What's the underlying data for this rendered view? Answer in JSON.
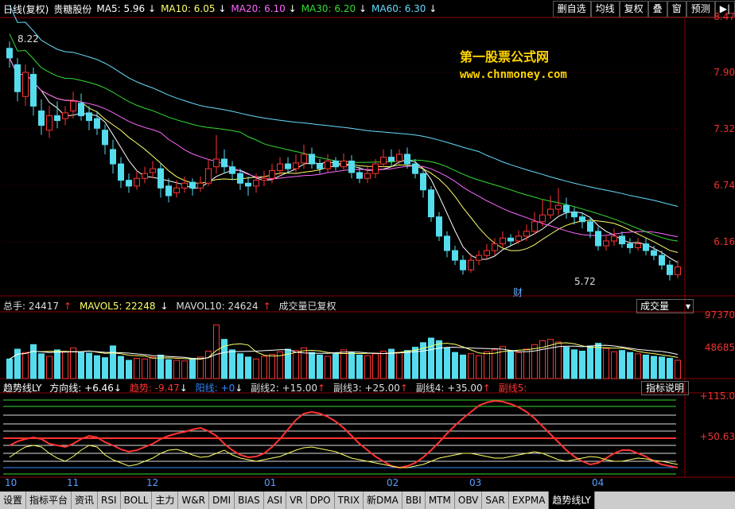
{
  "header": {
    "title": "日线(复权)",
    "stock": "贵糖股份",
    "ma": [
      {
        "label": "MA5: 5.96",
        "arrow": "↓",
        "color": "#ffffff"
      },
      {
        "label": "MA10: 6.05",
        "arrow": "↓",
        "color": "#ffff66"
      },
      {
        "label": "MA20: 6.10",
        "arrow": "↓",
        "color": "#ff66ff"
      },
      {
        "label": "MA30: 6.20",
        "arrow": "↓",
        "color": "#33dd33"
      },
      {
        "label": "MA60: 6.30",
        "arrow": "↓",
        "color": "#66ddff"
      }
    ],
    "buttons": [
      "删自选",
      "均线",
      "复权",
      "叠",
      "窗",
      "预测",
      "▶|"
    ]
  },
  "watermark": {
    "line1": "第一股票公式网",
    "line2": "www.chnmoney.com"
  },
  "price_axis": [
    "8.47",
    "7.90",
    "7.32",
    "6.74",
    "6.16"
  ],
  "annotations": {
    "high": "8.22",
    "low": "5.72",
    "cai": "财"
  },
  "volume": {
    "label_total": "总手: 24417",
    "total_arrow": "↑",
    "mavol5": "MAVOL5: 22248",
    "mavol5_arrow": "↓",
    "mavol10": "MAVOL10: 24624",
    "mavol10_arrow": "↑",
    "note": "成交量已复权",
    "selector": "成交量",
    "axis": [
      "97370",
      "48685"
    ]
  },
  "indicator": {
    "name": "趋势线LY",
    "items": [
      {
        "label": "方向线:",
        "value": "+6.46",
        "arrow": "↓",
        "color": "#ffffff"
      },
      {
        "label": "趋势:",
        "value": "-9.47",
        "arrow": "↓",
        "color": "#ff3333"
      },
      {
        "label": "阳线:",
        "value": "+0",
        "arrow": "↓",
        "color": "#3388ff"
      },
      {
        "label": "副线2:",
        "value": "+15.00",
        "arrow": "↑",
        "color": "#dddddd"
      },
      {
        "label": "副线3:",
        "value": "+25.00",
        "arrow": "↑",
        "color": "#dddddd"
      },
      {
        "label": "副线4:",
        "value": "+35.00",
        "arrow": "↑",
        "color": "#dddddd"
      },
      {
        "label": "副线5:",
        "value": "",
        "arrow": "",
        "color": "#ff3333"
      }
    ],
    "help": "指标说明",
    "axis": [
      "+115.0",
      "+50.63"
    ]
  },
  "months": [
    "10",
    "11",
    "12",
    "01",
    "02",
    "03",
    "04"
  ],
  "tabs": [
    "设置",
    "指标平台",
    "资讯",
    "RSI",
    "BOLL",
    "主力",
    "W&R",
    "DMI",
    "BIAS",
    "ASI",
    "VR",
    "DPO",
    "TRIX",
    "新DMA",
    "BBI",
    "MTM",
    "OBV",
    "SAR",
    "EXPMA",
    "趋势线LY"
  ],
  "chart_data": {
    "type": "candlestick",
    "ylim": [
      5.58,
      8.47
    ],
    "candles": [
      [
        8.15,
        8.05,
        8.22,
        7.95
      ],
      [
        7.98,
        7.7,
        8.05,
        7.6
      ],
      [
        7.65,
        7.9,
        7.98,
        7.55
      ],
      [
        7.88,
        7.55,
        7.95,
        7.45
      ],
      [
        7.5,
        7.35,
        7.62,
        7.25
      ],
      [
        7.3,
        7.45,
        7.55,
        7.22
      ],
      [
        7.45,
        7.4,
        7.6,
        7.32
      ],
      [
        7.42,
        7.48,
        7.55,
        7.35
      ],
      [
        7.5,
        7.6,
        7.7,
        7.42
      ],
      [
        7.58,
        7.45,
        7.68,
        7.4
      ],
      [
        7.48,
        7.4,
        7.55,
        7.3
      ],
      [
        7.42,
        7.32,
        7.5,
        7.25
      ],
      [
        7.3,
        7.15,
        7.36,
        7.05
      ],
      [
        7.1,
        6.95,
        7.2,
        6.85
      ],
      [
        6.95,
        6.78,
        7.02,
        6.7
      ],
      [
        6.78,
        6.72,
        6.85,
        6.65
      ],
      [
        6.72,
        6.8,
        6.88,
        6.68
      ],
      [
        6.8,
        6.85,
        6.92,
        6.75
      ],
      [
        6.86,
        6.9,
        6.98,
        6.8
      ],
      [
        6.9,
        6.7,
        6.95,
        6.6
      ],
      [
        6.72,
        6.62,
        6.8,
        6.55
      ],
      [
        6.65,
        6.7,
        6.78,
        6.6
      ],
      [
        6.7,
        6.75,
        6.82,
        6.65
      ],
      [
        6.76,
        6.7,
        6.8,
        6.62
      ],
      [
        6.7,
        6.75,
        6.82,
        6.66
      ],
      [
        6.75,
        6.9,
        7.0,
        6.72
      ],
      [
        6.92,
        7.0,
        7.25,
        6.85
      ],
      [
        7.0,
        6.92,
        7.1,
        6.85
      ],
      [
        6.92,
        6.85,
        6.98,
        6.78
      ],
      [
        6.85,
        6.75,
        6.9,
        6.68
      ],
      [
        6.75,
        6.72,
        6.82,
        6.62
      ],
      [
        6.72,
        6.78,
        6.85,
        6.65
      ],
      [
        6.78,
        6.8,
        6.88,
        6.72
      ],
      [
        6.8,
        6.88,
        6.95,
        6.75
      ],
      [
        6.88,
        6.95,
        7.02,
        6.82
      ],
      [
        6.95,
        6.9,
        7.02,
        6.85
      ],
      [
        6.9,
        6.96,
        7.05,
        6.86
      ],
      [
        6.96,
        7.05,
        7.15,
        6.9
      ],
      [
        7.05,
        6.95,
        7.12,
        6.9
      ],
      [
        6.95,
        6.9,
        7.0,
        6.85
      ],
      [
        6.9,
        6.98,
        7.05,
        6.86
      ],
      [
        6.98,
        6.92,
        7.02,
        6.88
      ],
      [
        6.92,
        6.98,
        7.06,
        6.88
      ],
      [
        6.98,
        6.86,
        7.04,
        6.8
      ],
      [
        6.86,
        6.8,
        6.92,
        6.75
      ],
      [
        6.8,
        6.85,
        6.92,
        6.75
      ],
      [
        6.85,
        6.95,
        7.0,
        6.8
      ],
      [
        6.95,
        7.02,
        7.1,
        6.92
      ],
      [
        7.02,
        6.98,
        7.1,
        6.92
      ],
      [
        6.98,
        7.05,
        7.1,
        6.95
      ],
      [
        7.05,
        6.95,
        7.12,
        6.9
      ],
      [
        6.95,
        6.85,
        7.0,
        6.8
      ],
      [
        6.85,
        6.68,
        6.9,
        6.6
      ],
      [
        6.68,
        6.4,
        6.72,
        6.35
      ],
      [
        6.4,
        6.2,
        6.45,
        6.15
      ],
      [
        6.2,
        6.05,
        6.25,
        5.98
      ],
      [
        6.05,
        5.95,
        6.1,
        5.9
      ],
      [
        5.95,
        5.85,
        6.0,
        5.8
      ],
      [
        5.85,
        5.95,
        6.02,
        5.82
      ],
      [
        5.95,
        6.0,
        6.05,
        5.9
      ],
      [
        6.0,
        6.05,
        6.12,
        5.96
      ],
      [
        6.05,
        6.12,
        6.18,
        6.0
      ],
      [
        6.12,
        6.18,
        6.25,
        6.08
      ],
      [
        6.18,
        6.15,
        6.22,
        6.1
      ],
      [
        6.15,
        6.2,
        6.26,
        6.12
      ],
      [
        6.2,
        6.25,
        6.32,
        6.15
      ],
      [
        6.25,
        6.35,
        6.45,
        6.22
      ],
      [
        6.35,
        6.42,
        6.58,
        6.3
      ],
      [
        6.42,
        6.48,
        6.62,
        6.38
      ],
      [
        6.48,
        6.52,
        6.7,
        6.42
      ],
      [
        6.52,
        6.45,
        6.6,
        6.38
      ],
      [
        6.45,
        6.4,
        6.5,
        6.32
      ],
      [
        6.4,
        6.35,
        6.45,
        6.28
      ],
      [
        6.35,
        6.25,
        6.4,
        6.18
      ],
      [
        6.25,
        6.1,
        6.3,
        6.05
      ],
      [
        6.1,
        6.15,
        6.2,
        6.05
      ],
      [
        6.15,
        6.2,
        6.28,
        6.1
      ],
      [
        6.2,
        6.12,
        6.25,
        6.08
      ],
      [
        6.12,
        6.08,
        6.18,
        6.02
      ],
      [
        6.08,
        6.12,
        6.18,
        6.05
      ],
      [
        6.12,
        6.05,
        6.18,
        6.0
      ],
      [
        6.05,
        6.0,
        6.1,
        5.95
      ],
      [
        6.0,
        5.9,
        6.05,
        5.85
      ],
      [
        5.9,
        5.8,
        5.95,
        5.74
      ],
      [
        5.8,
        5.88,
        5.95,
        5.76
      ]
    ],
    "volume": [
      30,
      45,
      40,
      52,
      38,
      34,
      44,
      41,
      47,
      40,
      39,
      35,
      32,
      50,
      34,
      28,
      31,
      30,
      33,
      36,
      29,
      28,
      27,
      31,
      33,
      42,
      82,
      60,
      44,
      38,
      33,
      30,
      34,
      37,
      41,
      45,
      43,
      47,
      40,
      36,
      34,
      38,
      44,
      40,
      36,
      35,
      38,
      42,
      45,
      40,
      43,
      48,
      55,
      62,
      58,
      47,
      40,
      36,
      38,
      35,
      41,
      44,
      49,
      43,
      40,
      45,
      52,
      58,
      60,
      56,
      48,
      44,
      42,
      50,
      54,
      46,
      41,
      43,
      40,
      38,
      36,
      34,
      33,
      31,
      28
    ],
    "vol_ylim": [
      0,
      97370
    ]
  }
}
